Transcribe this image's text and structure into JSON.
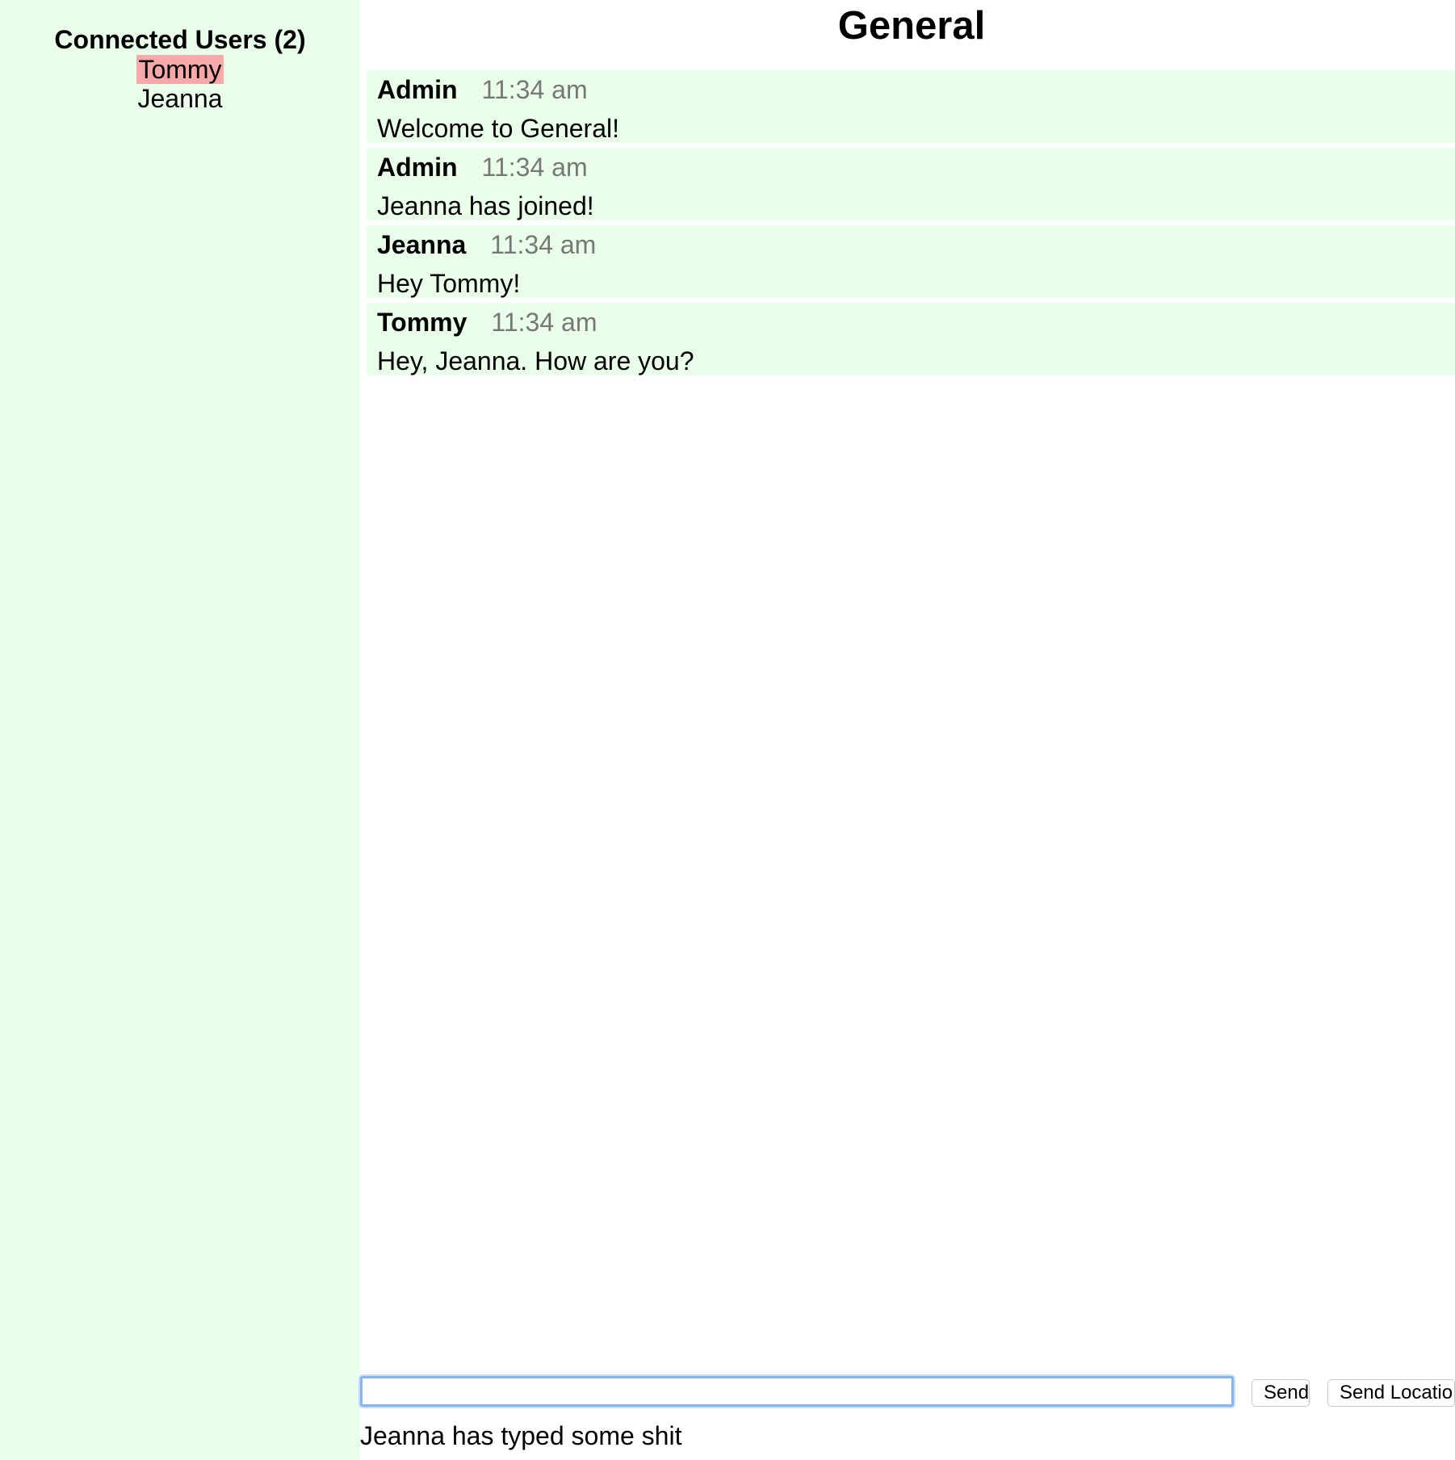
{
  "sidebar": {
    "title": "Connected Users (2)",
    "users": [
      "Tommy",
      "Jeanna"
    ],
    "highlight_color": "#f7a8a8",
    "background_color": "#eaffea"
  },
  "room": {
    "title": "General"
  },
  "messages": [
    {
      "author": "Admin",
      "time": "11:34 am",
      "text": "Welcome to General!"
    },
    {
      "author": "Admin",
      "time": "11:34 am",
      "text": "Jeanna has joined!"
    },
    {
      "author": "Jeanna",
      "time": "11:34 am",
      "text": "Hey Tommy!"
    },
    {
      "author": "Tommy",
      "time": "11:34 am",
      "text": "Hey, Jeanna. How are you?"
    }
  ],
  "composer": {
    "input_value": "",
    "send_label": "Send",
    "location_label": "Send Locatio"
  },
  "typing_status": "Jeanna has typed some shit"
}
